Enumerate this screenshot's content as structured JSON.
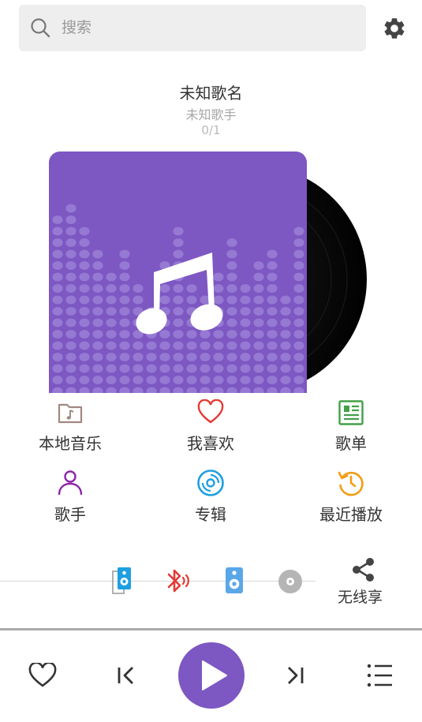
{
  "search": {
    "placeholder": "搜索"
  },
  "track": {
    "title": "未知歌名",
    "artist": "未知歌手",
    "index": "0/1"
  },
  "features": [
    {
      "label": "本地音乐",
      "icon": "folder-music-icon",
      "color": "#a1887f"
    },
    {
      "label": "我喜欢",
      "icon": "heart-icon",
      "color": "#e53935"
    },
    {
      "label": "歌单",
      "icon": "playlist-icon",
      "color": "#43a047"
    },
    {
      "label": "歌手",
      "icon": "person-icon",
      "color": "#8e24aa"
    },
    {
      "label": "专辑",
      "icon": "album-disc-icon",
      "color": "#1e9fe0"
    },
    {
      "label": "最近播放",
      "icon": "history-icon",
      "color": "#f39c12"
    }
  ],
  "output": {
    "devices": [
      {
        "icon": "local-speaker-icon",
        "color": "#1e9fe0"
      },
      {
        "icon": "bluetooth-icon",
        "color": "#e53935"
      },
      {
        "icon": "speaker-icon",
        "color": "#5aa7e8"
      },
      {
        "icon": "cd-icon",
        "color": "#b5b5b5"
      }
    ],
    "wireless_label": "无线享"
  },
  "player": {
    "accent": "#7d57c2"
  }
}
